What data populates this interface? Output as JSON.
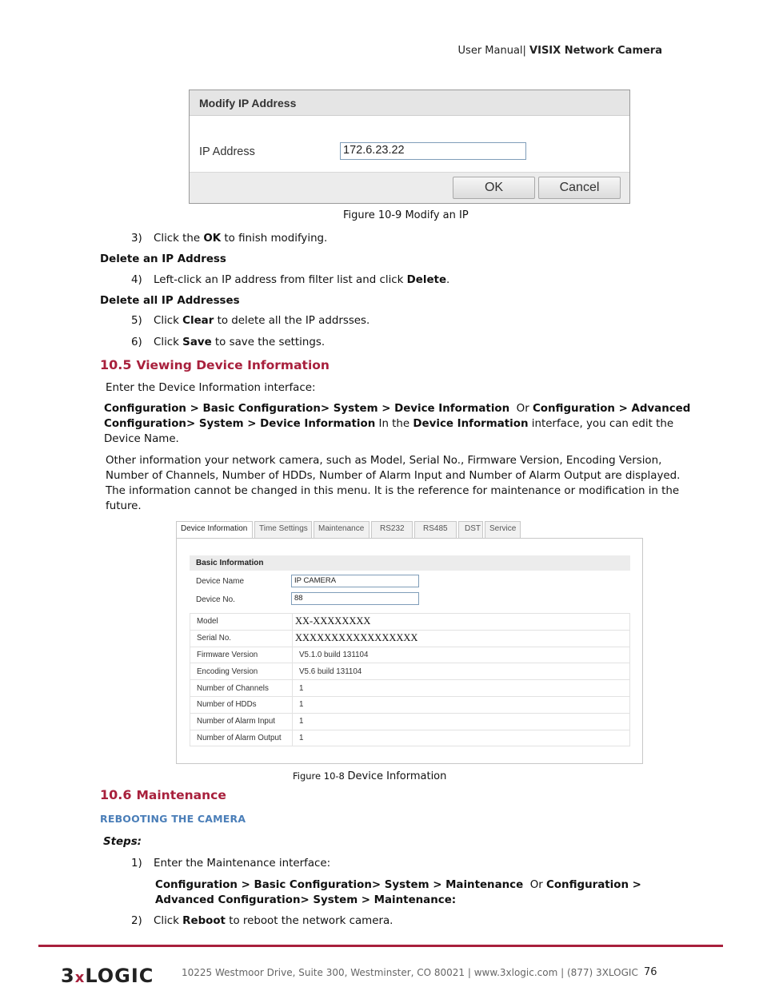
{
  "header": {
    "prefix": "User Manual| ",
    "brand": "VISIX Network Camera"
  },
  "modify_ip_dialog": {
    "title": "Modify IP Address",
    "ip_label": "IP Address",
    "ip_value": "172.6.23.22",
    "ok_label": "OK",
    "cancel_label": "Cancel"
  },
  "fig_10_9_caption": "Figure 10-9 Modify an IP",
  "steps_a": [
    {
      "num": "3)",
      "pre": "Click the ",
      "bold": "OK",
      "post": " to finish modifying."
    }
  ],
  "delete_ip": {
    "heading": "Delete an IP Address",
    "step": {
      "num": "4)",
      "pre": "Left-click an IP address from filter list and click ",
      "bold": "Delete",
      "post": "."
    }
  },
  "delete_all": {
    "heading": "Delete all IP Addresses",
    "steps": [
      {
        "num": "5)",
        "pre": "Click ",
        "bold": "Clear",
        "post": " to delete all the IP addrsses."
      },
      {
        "num": "6)",
        "pre": "Click ",
        "bold": "Save",
        "post": " to save the settings."
      }
    ]
  },
  "section_10_5": {
    "number": "10.5",
    "title": "Viewing Device Information",
    "intro": "Enter the Device Information interface:",
    "path_b1": "Configuration > Basic Configuration> System > Device Information",
    "path_or": "  Or ",
    "path_b2": "Configuration > Advanced",
    "path_b3": "Configuration> System > Device Information",
    "path_mid": " In the ",
    "path_b4": "Device Information",
    "path_end": " interface, you can edit the",
    "path_end2": "Device Name.",
    "para_lines": [
      "Other information your network camera, such as Model, Serial No., Firmware Version, Encoding Version,",
      "Number of Channels, Number of HDDs, Number of Alarm Input and Number of Alarm Output are displayed.",
      "The information cannot be changed in this menu. It is the reference for maintenance or modification in the",
      "future."
    ]
  },
  "device_info_ui": {
    "tabs": [
      {
        "label": "Device Information",
        "active": true
      },
      {
        "label": "Time Settings",
        "active": false
      },
      {
        "label": "Maintenance",
        "active": false
      },
      {
        "label": "RS232",
        "active": false
      },
      {
        "label": "RS485",
        "active": false
      },
      {
        "label": "DST",
        "active": false
      },
      {
        "label": "Service",
        "active": false
      }
    ],
    "section_title": "Basic Information",
    "device_name_label": "Device Name",
    "device_name_value": "IP CAMERA",
    "device_no_label": "Device No.",
    "device_no_value": "88",
    "rows": [
      {
        "label": "Model",
        "value": "XX-XXXXXXXX"
      },
      {
        "label": "Serial No.",
        "value": "XXXXXXXXXXXXXXXXX"
      },
      {
        "label": "Firmware Version",
        "value": "V5.1.0 build 131104"
      },
      {
        "label": "Encoding Version",
        "value": "V5.6 build 131104"
      },
      {
        "label": "Number of Channels",
        "value": "1"
      },
      {
        "label": "Number of HDDs",
        "value": "1"
      },
      {
        "label": "Number of Alarm Input",
        "value": "1"
      },
      {
        "label": "Number of Alarm Output",
        "value": "1"
      }
    ]
  },
  "fig_10_8_caption": {
    "prefix": "Figure 10-8 ",
    "rest": "Device Information"
  },
  "section_10_6": {
    "number": "10.6",
    "title": "Maintenance",
    "subheading": "REBOOTING THE CAMERA",
    "steps_label": "Steps:",
    "step1": {
      "num": "1)",
      "text": "Enter the Maintenance interface:"
    },
    "path_b1": "Configuration > Basic Configuration> System > Maintenance",
    "path_or": "  Or ",
    "path_b2": "Configuration >",
    "path_b3": "Advanced Configuration> System > Maintenance:",
    "step2": {
      "num": "2)",
      "pre": "Click ",
      "bold": "Reboot",
      "post": " to reboot the network camera."
    }
  },
  "footer": {
    "logo_a": "3",
    "logo_x": "x",
    "logo_b": "LOGIC",
    "address": "10225 Westmoor Drive, Suite 300, Westminster, CO 80021 | www.3xlogic.com | (877) 3XLOGIC",
    "page_number": "76",
    "accent_color": "#a8203c"
  }
}
